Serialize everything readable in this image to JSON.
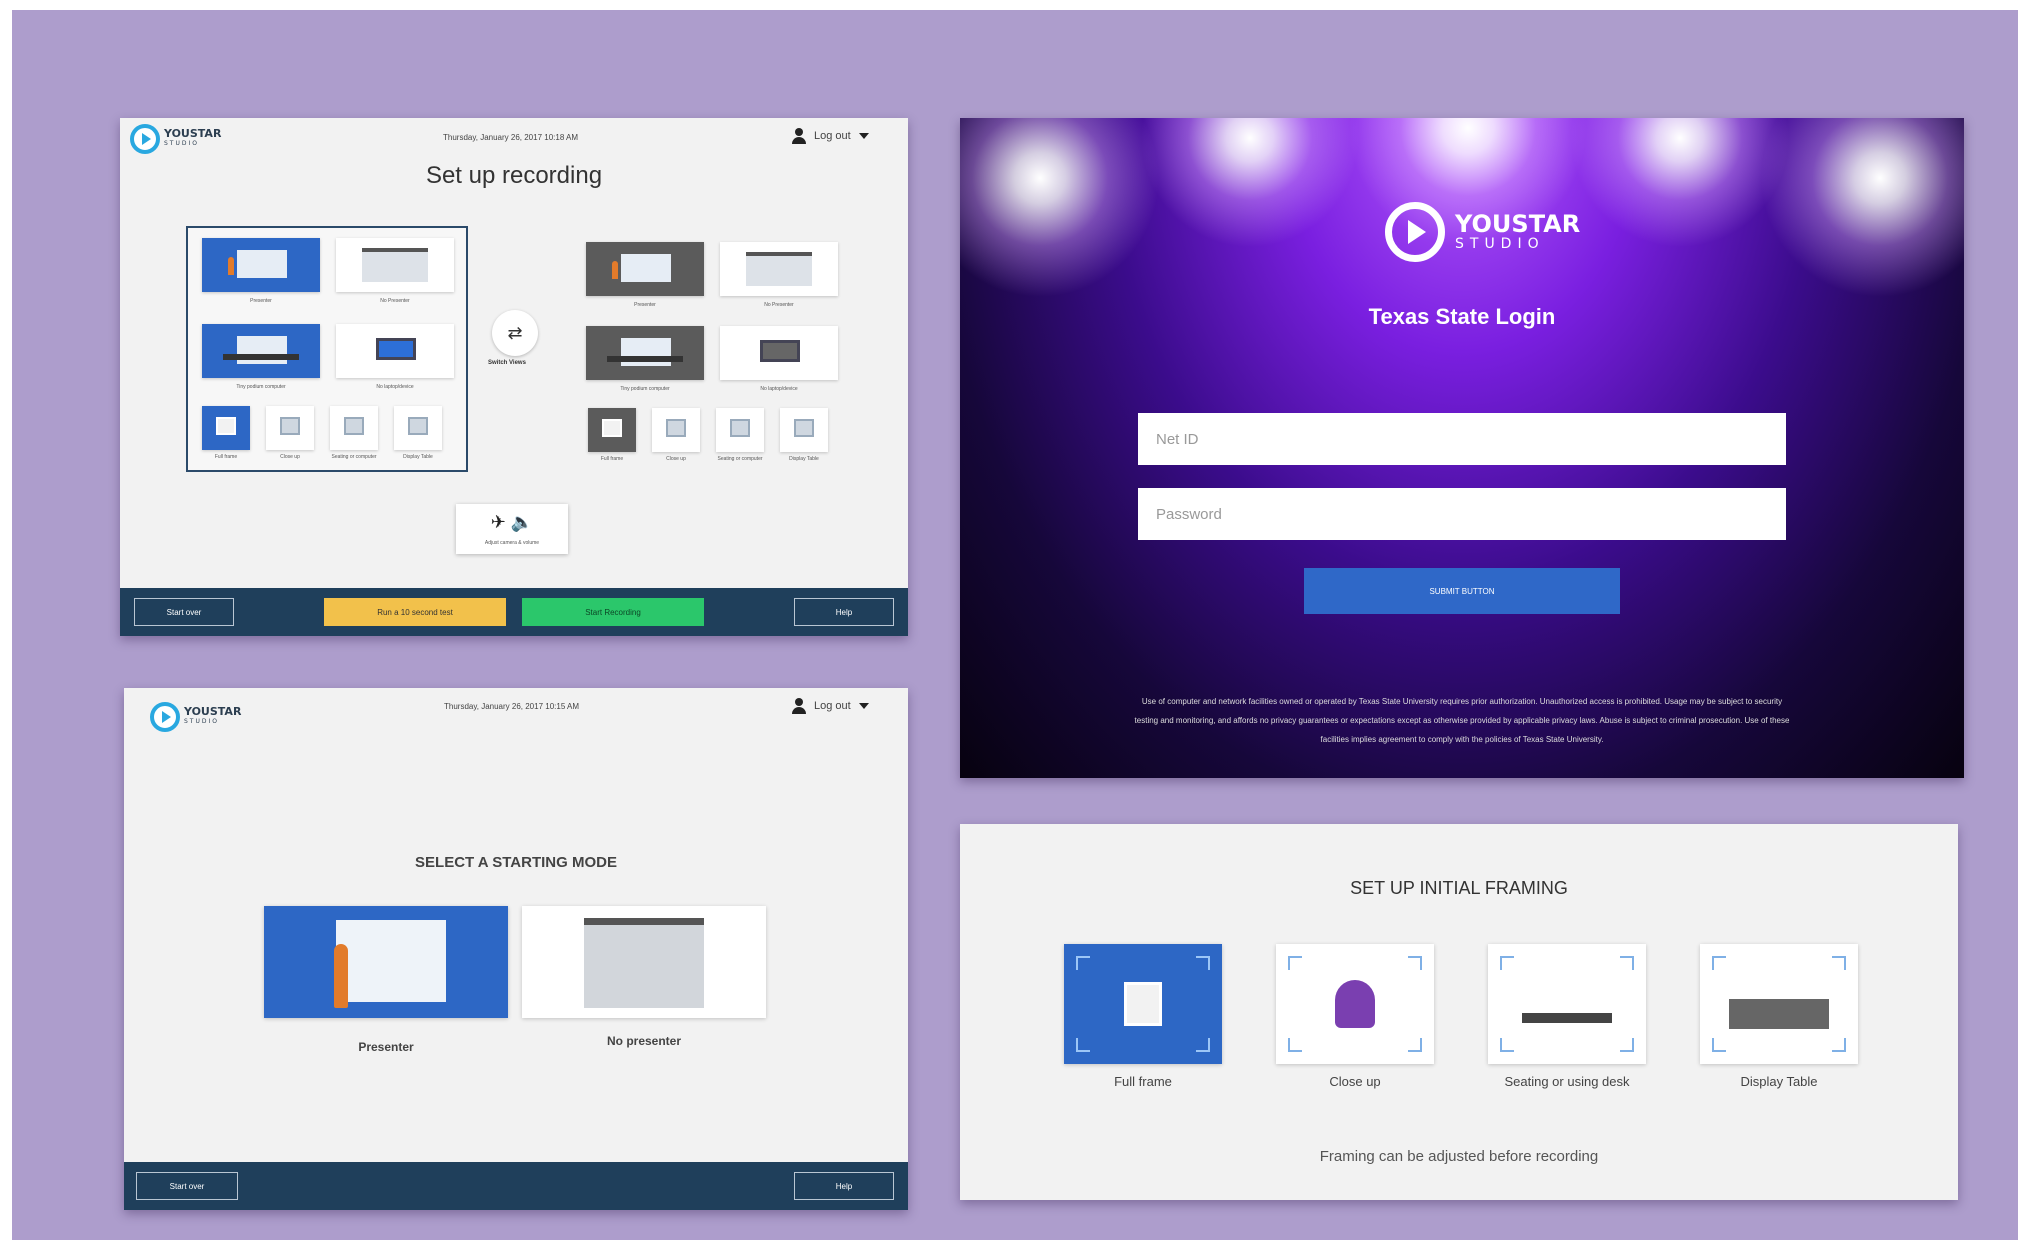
{
  "brand": {
    "name": "YOUSTAR",
    "sub": "STUDIO"
  },
  "setup_recording": {
    "date": "Thursday, January 26, 2017 10:18 AM",
    "logout": "Log out",
    "title": "Set up recording",
    "switch_views": "Switch Views",
    "camera_label": "Adjust camera & volume",
    "camera_icon": "camera-icon",
    "speaker_icon": "speaker-icon",
    "left_thumbs": [
      "Presenter",
      "No Presenter",
      "Tiny podium computer",
      "No laptop/device"
    ],
    "left_small": [
      "Full frame",
      "Close up",
      "Seating or computer",
      "Display Table"
    ],
    "right_thumbs": [
      "Presenter",
      "No Presenter",
      "Tiny podium computer",
      "No laptop/device"
    ],
    "right_small": [
      "Full frame",
      "Close up",
      "Seating or computer",
      "Display Table"
    ],
    "footer": {
      "start_over": "Start over",
      "test": "Run a 10 second test",
      "start_recording": "Start Recording",
      "help": "Help"
    }
  },
  "login": {
    "title": "Texas State Login",
    "netid_placeholder": "Net ID",
    "password_placeholder": "Password",
    "submit": "SUBMIT BUTTON",
    "disclaimer": "Use of computer and network facilities owned or operated by Texas State University requires prior authorization. Unauthorized access is prohibited. Usage may be subject to security testing and monitoring, and affords no privacy guarantees or expectations except as otherwise provided by applicable privacy laws. Abuse is subject to criminal prosecution. Use of these facilities implies agreement to comply with the policies of Texas State University."
  },
  "starting_mode": {
    "date": "Thursday, January 26, 2017 10:15 AM",
    "logout": "Log out",
    "title": "SELECT A STARTING MODE",
    "modes": [
      "Presenter",
      "No presenter"
    ],
    "footer": {
      "start_over": "Start over",
      "help": "Help"
    }
  },
  "framing": {
    "title": "SET UP INITIAL FRAMING",
    "options": [
      "Full frame",
      "Close up",
      "Seating or using desk",
      "Display Table"
    ],
    "note": "Framing can be adjusted before recording"
  },
  "colors": {
    "backdrop": "#ad9dcc",
    "accent_blue": "#2d67c5",
    "footer_navy": "#1f3f5b",
    "yellow": "#f2c14b",
    "green": "#2bc76b"
  }
}
